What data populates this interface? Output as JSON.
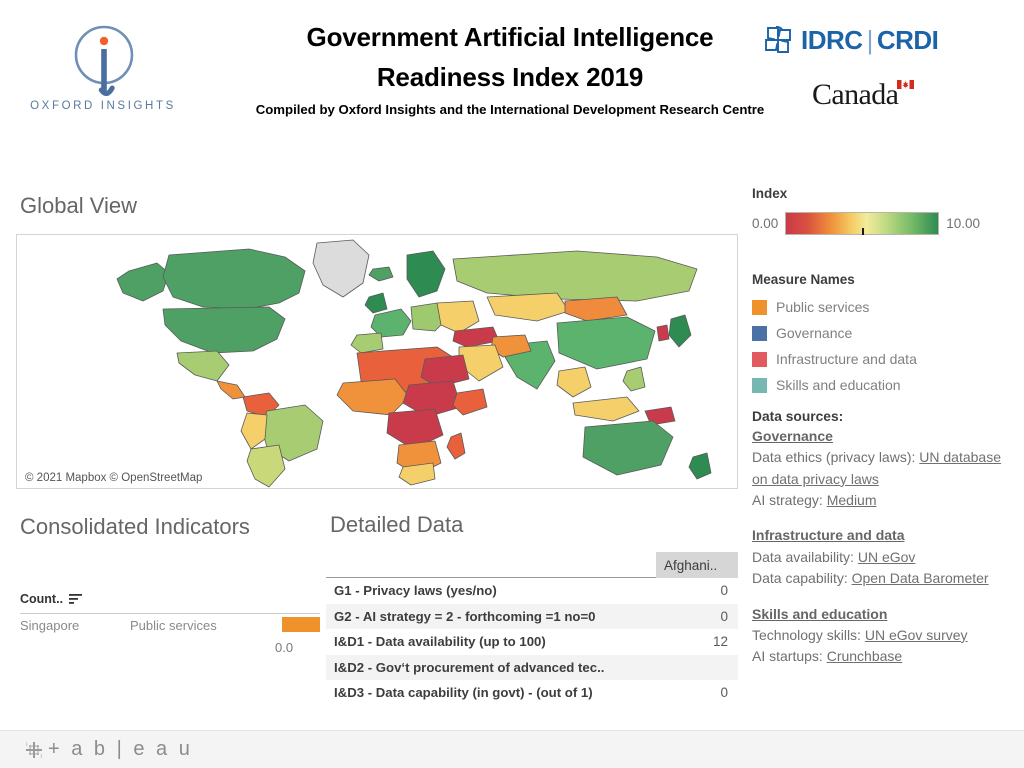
{
  "header": {
    "title_line1": "Government Artificial Intelligence",
    "title_line2": "Readiness  Index 2019",
    "subtitle": "Compiled by Oxford Insights and the International Development Research Centre",
    "oxford_wordmark": "OXFORD INSIGHTS",
    "idrc_en": "IDRC",
    "idrc_sep": "|",
    "idrc_fr": "CRDI",
    "canada_wordmark": "Canada"
  },
  "map": {
    "title": "Global View",
    "attribution": "© 2021 Mapbox  © OpenStreetMap"
  },
  "consolidated": {
    "title": "Consolidated Indicators",
    "column_header": "Count..",
    "rows": [
      {
        "country": "Singapore",
        "measure": "Public services",
        "bar_color": "#f0922b"
      }
    ],
    "axis_label": "0.0"
  },
  "detailed": {
    "title": "Detailed Data",
    "column_header": "Afghani..",
    "rows": [
      {
        "label": "G1 - Privacy laws (yes/no)",
        "value": "0"
      },
      {
        "label": "G2 - AI strategy = 2 - forthcoming =1  no=0",
        "value": "0"
      },
      {
        "label": "I&D1 - Data availability (up to 100)",
        "value": "12"
      },
      {
        "label": "I&D2 - Gov‘t procurement of advanced tec..",
        "value": ""
      },
      {
        "label": "I&D3 - Data capability (in govt) - (out of 1)",
        "value": "0"
      }
    ]
  },
  "legend": {
    "index_label": "Index",
    "min": "0.00",
    "max": "10.00",
    "gradient_stops": [
      "#c93b4a",
      "#e05a3e",
      "#f0923b",
      "#f5d06a",
      "#f2ec9c",
      "#b6d67f",
      "#7cbf6b",
      "#2e8b52"
    ],
    "measure_names_label": "Measure Names",
    "measures": [
      {
        "label": "Public services",
        "color": "#f0922b"
      },
      {
        "label": "Governance",
        "color": "#4a72a4"
      },
      {
        "label": "Infrastructure and data",
        "color": "#e15a60"
      },
      {
        "label": "Skills and education",
        "color": "#76b7b2"
      }
    ]
  },
  "data_sources": {
    "heading": "Data sources:",
    "groups": [
      {
        "name": "Governance",
        "lines": [
          {
            "prefix": "Data ethics (privacy laws): ",
            "link": "UN database on data privacy laws"
          },
          {
            "prefix": "AI strategy: ",
            "link": "Medium "
          }
        ]
      },
      {
        "name": "Infrastructure and data",
        "lines": [
          {
            "prefix": "Data availability: ",
            "link": "UN eGov"
          },
          {
            "prefix": "Data capability: ",
            "link": "Open Data Barometer"
          }
        ]
      },
      {
        "name": "Skills and education",
        "lines": [
          {
            "prefix": "Technology skills:  ",
            "link": "UN eGov survey"
          },
          {
            "prefix": "AI startups: ",
            "link": "Crunchbase"
          }
        ]
      }
    ]
  },
  "footer": {
    "brand": "+ a b | e a u"
  }
}
